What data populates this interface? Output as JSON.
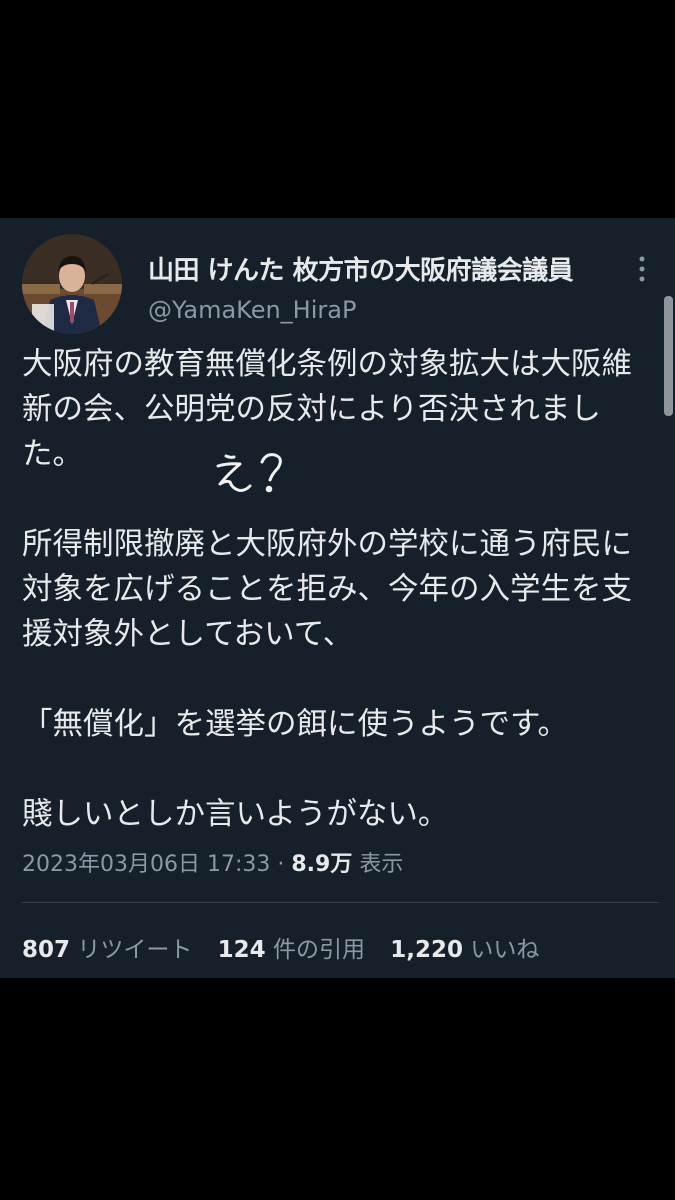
{
  "tweet": {
    "author": {
      "name": "山田 けんた 枚方市の大阪府議会議員",
      "handle": "@YamaKen_HiraP"
    },
    "body": [
      "大阪府の教育無償化条例の対象拡大は大阪維新の会、公明党の反対により否決されました。",
      "",
      "所得制限撤廃と大阪府外の学校に通う府民に対象を広げることを拒み、今年の入学生を支援対象外としておいて、",
      "",
      "「無償化」を選挙の餌に使うようです。",
      "",
      "賤しいとしか言いようがない。"
    ],
    "annotation": "え?",
    "timestamp": "2023年03月06日 17:33",
    "separator": "·",
    "views_count": "8.9万",
    "views_label": "表示",
    "stats": {
      "retweets_count": "807",
      "retweets_label": "リツイート",
      "quotes_count": "124",
      "quotes_label": "件の引用",
      "likes_count": "1,220",
      "likes_label": "いいね"
    }
  },
  "icons": {
    "more": "more-vertical-icon",
    "avatar": "profile-photo"
  }
}
